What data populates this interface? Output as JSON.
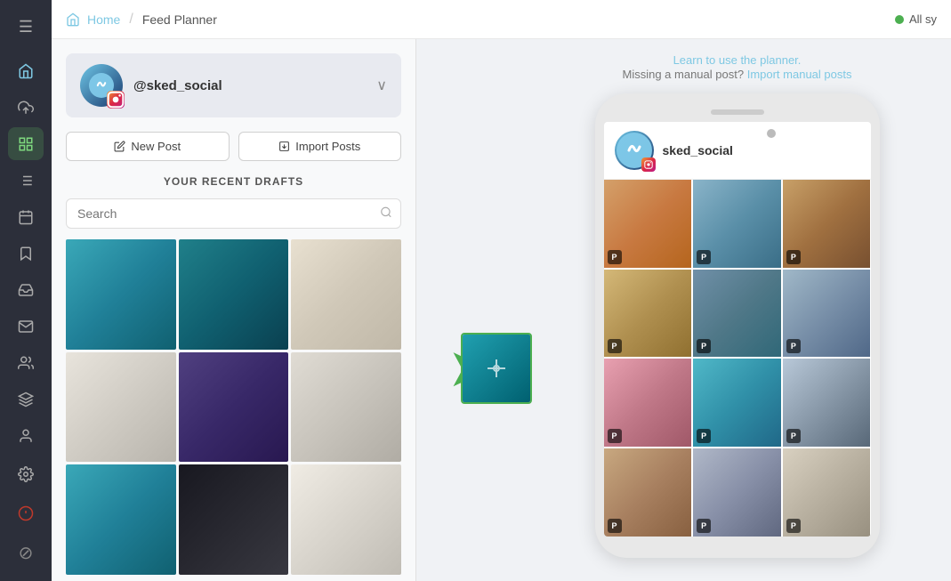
{
  "sidebar": {
    "items": [
      {
        "id": "menu",
        "icon": "☰",
        "label": "Menu"
      },
      {
        "id": "home",
        "icon": "⌂",
        "label": "Home"
      },
      {
        "id": "upload",
        "icon": "↑",
        "label": "Upload"
      },
      {
        "id": "planner",
        "icon": "▦",
        "label": "Feed Planner",
        "active": true
      },
      {
        "id": "list",
        "icon": "≡",
        "label": "List"
      },
      {
        "id": "calendar",
        "icon": "▦",
        "label": "Calendar"
      },
      {
        "id": "bookmark",
        "icon": "🔖",
        "label": "Saved"
      },
      {
        "id": "inbox",
        "icon": "✉",
        "label": "Inbox"
      },
      {
        "id": "mail",
        "icon": "📧",
        "label": "Mail"
      },
      {
        "id": "users",
        "icon": "👥",
        "label": "Users"
      },
      {
        "id": "layers",
        "icon": "◫",
        "label": "Layers"
      },
      {
        "id": "person",
        "icon": "👤",
        "label": "Account"
      }
    ],
    "bottomItems": [
      {
        "id": "settings",
        "icon": "⚙",
        "label": "Settings"
      },
      {
        "id": "alert",
        "icon": "⚠",
        "label": "Alerts"
      },
      {
        "id": "circle-slash",
        "icon": "⊘",
        "label": "None"
      }
    ]
  },
  "topbar": {
    "home_label": "Home",
    "separator": "/",
    "title": "Feed Planner",
    "status": "All sy"
  },
  "account": {
    "handle": "@sked_social"
  },
  "buttons": {
    "new_post": "New Post",
    "import_posts": "Import Posts"
  },
  "drafts": {
    "section_title": "YOUR RECENT DRAFTS",
    "search_placeholder": "Search"
  },
  "helper": {
    "learn_text": "Learn to use the planner.",
    "missing_text": "Missing a manual post?",
    "import_link": "Import manual posts"
  },
  "phone": {
    "username": "sked_social"
  },
  "grid_items": [
    {
      "id": 1,
      "class": "img-warm-woman",
      "badge": "P"
    },
    {
      "id": 2,
      "class": "img-beanie-woman",
      "badge": "P"
    },
    {
      "id": 3,
      "class": "img-burger",
      "badge": "P"
    },
    {
      "id": 4,
      "class": "img-burger2",
      "badge": "P"
    },
    {
      "id": 5,
      "class": "img-couple",
      "badge": "P"
    },
    {
      "id": 6,
      "class": "img-winter",
      "badge": "P"
    },
    {
      "id": 7,
      "class": "img-cupcake-pink",
      "badge": "P"
    },
    {
      "id": 8,
      "class": "img-cupcake-teal",
      "badge": "P"
    },
    {
      "id": 9,
      "class": "img-snowy",
      "badge": "P"
    }
  ],
  "draft_grid": [
    {
      "id": 1,
      "class": "img-teal-item"
    },
    {
      "id": 2,
      "class": "img-teal-texture"
    },
    {
      "id": 3,
      "class": "img-light"
    },
    {
      "id": 4,
      "class": "img-light"
    },
    {
      "id": 5,
      "class": "img-rope"
    },
    {
      "id": 6,
      "class": "img-light"
    },
    {
      "id": 7,
      "class": "img-teal-item"
    },
    {
      "id": 8,
      "class": "img-braided"
    },
    {
      "id": 9,
      "class": "img-cream"
    }
  ]
}
